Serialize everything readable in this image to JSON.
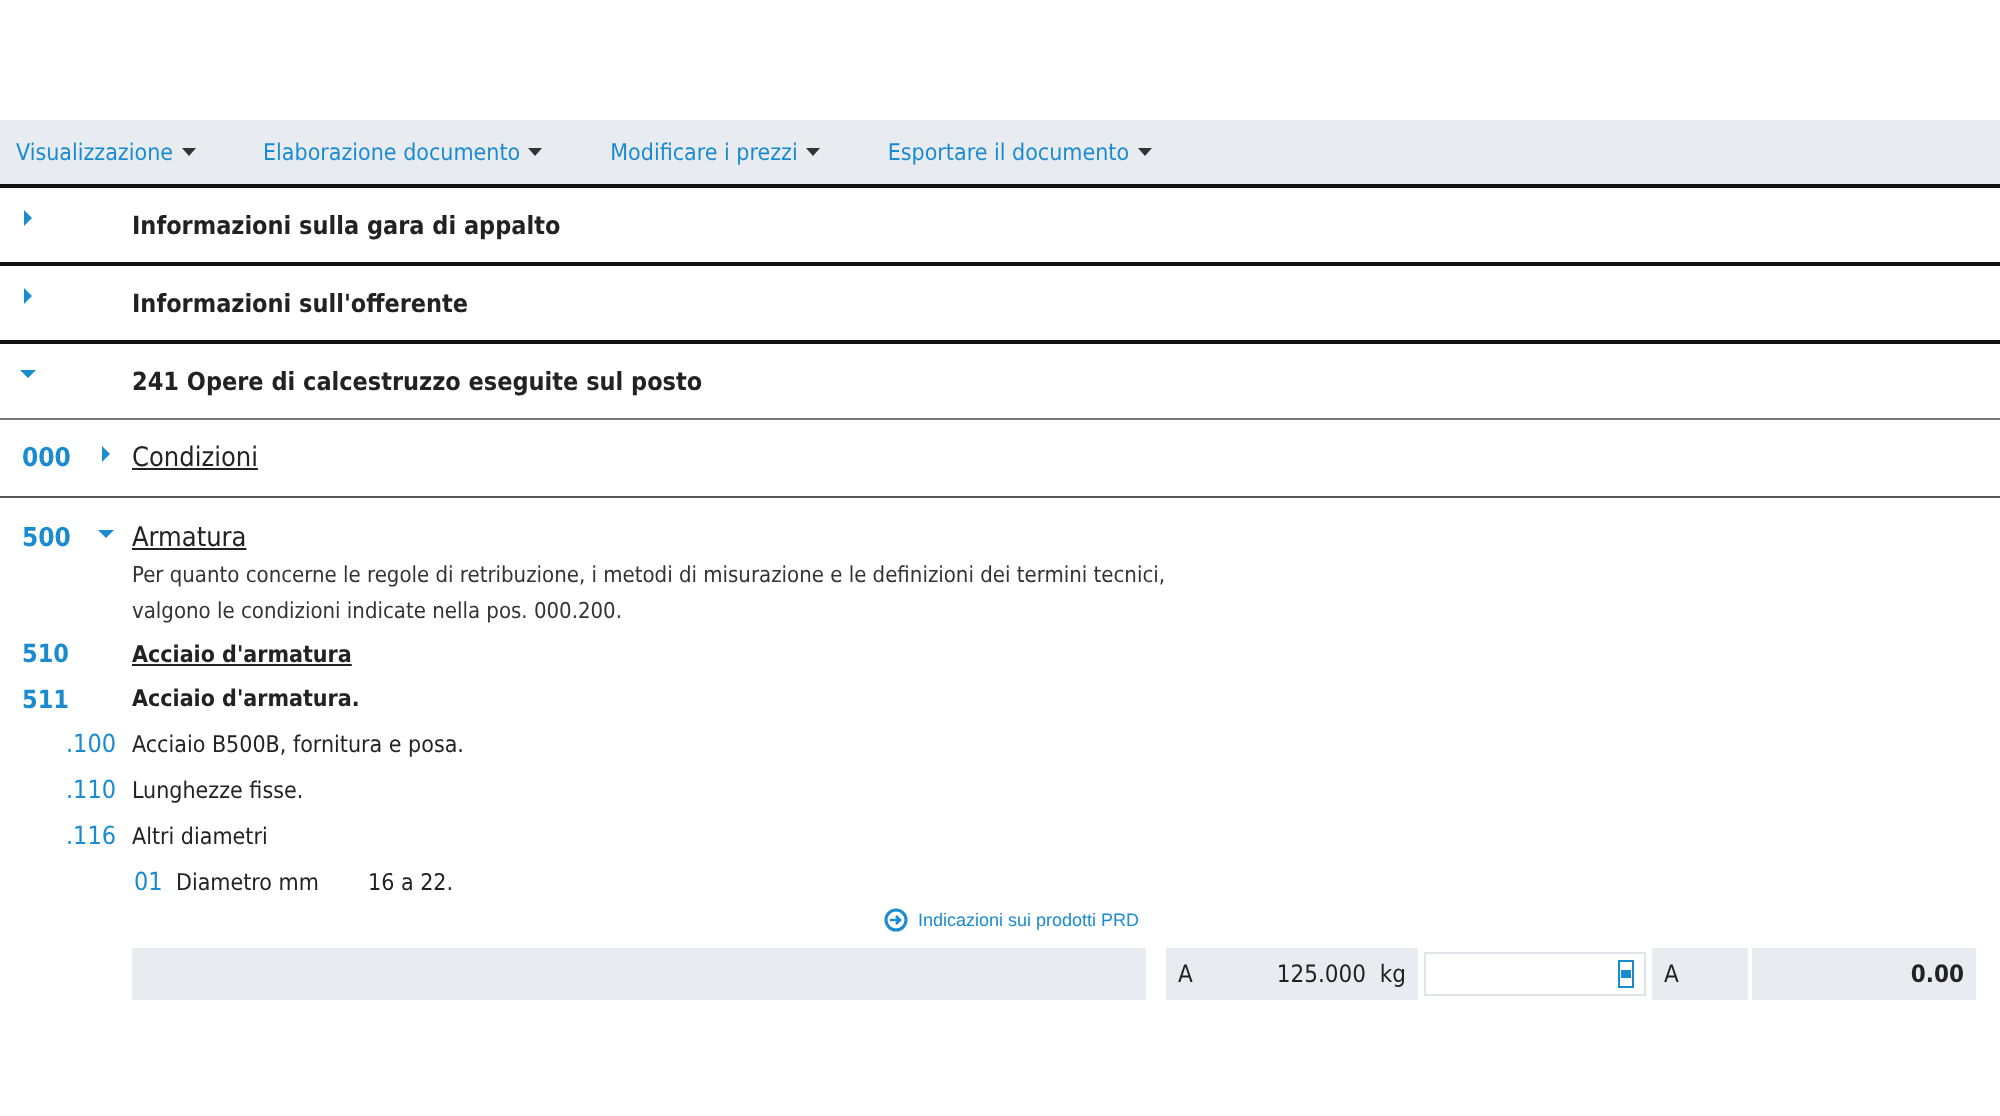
{
  "menu": [
    {
      "label": "Visualizzazione"
    },
    {
      "label": "Elaborazione documento"
    },
    {
      "label": "Modificare i prezzi"
    },
    {
      "label": "Esportare il documento"
    }
  ],
  "sections": [
    {
      "title": "Informazioni sulla gara di appalto",
      "expanded": false
    },
    {
      "title": "Informazioni sull'offerente",
      "expanded": false
    },
    {
      "title": "241 Opere di calcestruzzo eseguite sul posto",
      "expanded": true
    }
  ],
  "groups": [
    {
      "number": "000",
      "title": "Condizioni",
      "expanded": false
    },
    {
      "number": "500",
      "title": "Armatura",
      "expanded": true,
      "text": "Per quanto concerne le regole di retribuzione, i metodi di misurazione e le definizioni dei termini tecnici, valgono le condizioni indicate nella pos. 000.200."
    }
  ],
  "positions": [
    {
      "kind": "heading",
      "number": "510",
      "text": "Acciaio d'armatura"
    },
    {
      "kind": "title",
      "number": "511",
      "text": "Acciaio d'armatura."
    },
    {
      "kind": "line",
      "number": ".100",
      "text": "Acciaio B500B, fornitura e posa."
    },
    {
      "kind": "line",
      "number": ".110",
      "text": "Lunghezze fisse."
    },
    {
      "kind": "line",
      "number": ".116",
      "text": "Altri diametri"
    },
    {
      "kind": "variable",
      "number": "01",
      "text": "Diametro mm",
      "value": "16 a 22."
    }
  ],
  "product_link": "Indicazioni sui prodotti PRD",
  "quantity": {
    "unit_code": "A",
    "amount": "125.000",
    "unit": "kg",
    "price_code": "A",
    "total": "0.00"
  }
}
